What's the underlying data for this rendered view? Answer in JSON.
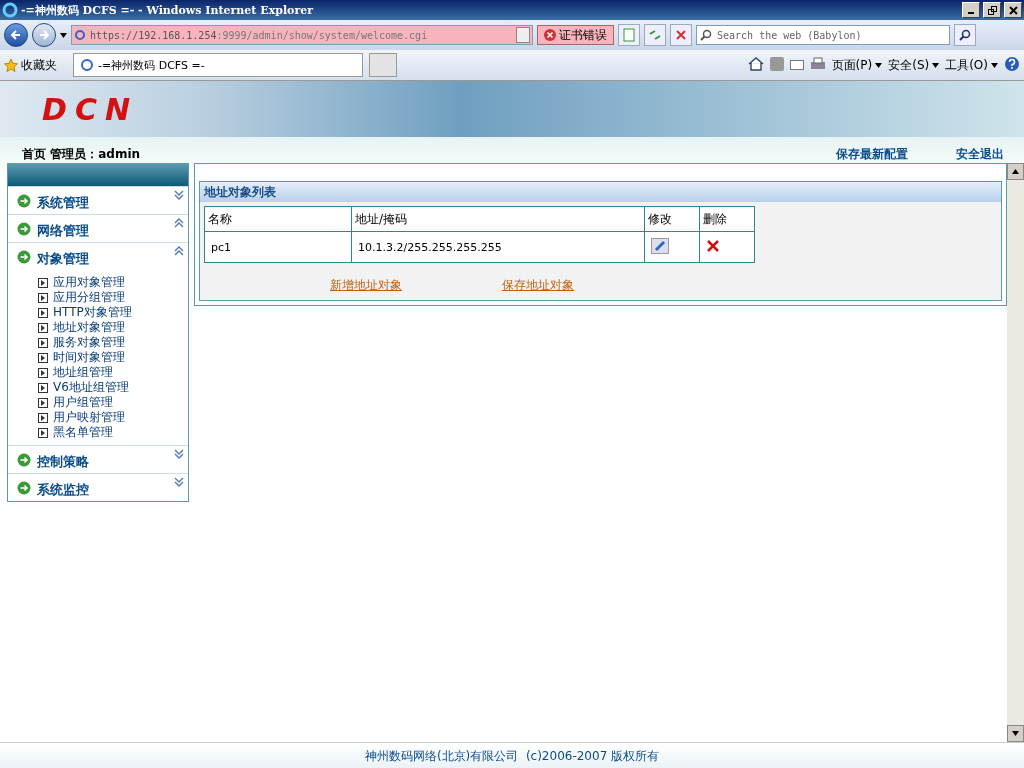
{
  "window": {
    "title": "-=神州数码 DCFS =- - Windows Internet Explorer"
  },
  "address_bar": {
    "url_host": "https://192.168.1.254",
    "url_rest": ":9999/admin/show/system/welcome.cgi",
    "cert_error": "证书错误"
  },
  "search": {
    "placeholder": "Search the web (Babylon)"
  },
  "favorites": {
    "label": "收藏夹"
  },
  "tab": {
    "title": "-=神州数码 DCFS =-"
  },
  "commands": [
    "页面(P)",
    "安全(S)",
    "工具(O)"
  ],
  "banner": {
    "logo": "DCN"
  },
  "header": {
    "home": "首页",
    "admin": "管理员：admin",
    "actions": [
      "保存最新配置",
      "安全退出"
    ]
  },
  "sidebar": {
    "sections": [
      {
        "label": "系统管理",
        "expanded": false
      },
      {
        "label": "网络管理",
        "expanded": true
      },
      {
        "label": "对象管理",
        "expanded": true,
        "children": [
          "应用对象管理",
          "应用分组管理",
          "HTTP对象管理",
          "地址对象管理",
          "服务对象管理",
          "时间对象管理",
          "地址组管理",
          "V6地址组管理",
          "用户组管理",
          "用户映射管理",
          "黑名单管理"
        ]
      },
      {
        "label": "控制策略",
        "expanded": false
      },
      {
        "label": "系统监控",
        "expanded": false
      }
    ]
  },
  "panel": {
    "title": "地址对象列表",
    "columns": [
      "名称",
      "地址/掩码",
      "修改",
      "删除"
    ],
    "rows": [
      {
        "name": "pc1",
        "address": "10.1.3.2/255.255.255.255"
      }
    ],
    "links": [
      "新增地址对象",
      "保存地址对象"
    ]
  },
  "footer": {
    "text": "神州数码网络(北京)有限公司  (c)2006-2007 版权所有"
  }
}
